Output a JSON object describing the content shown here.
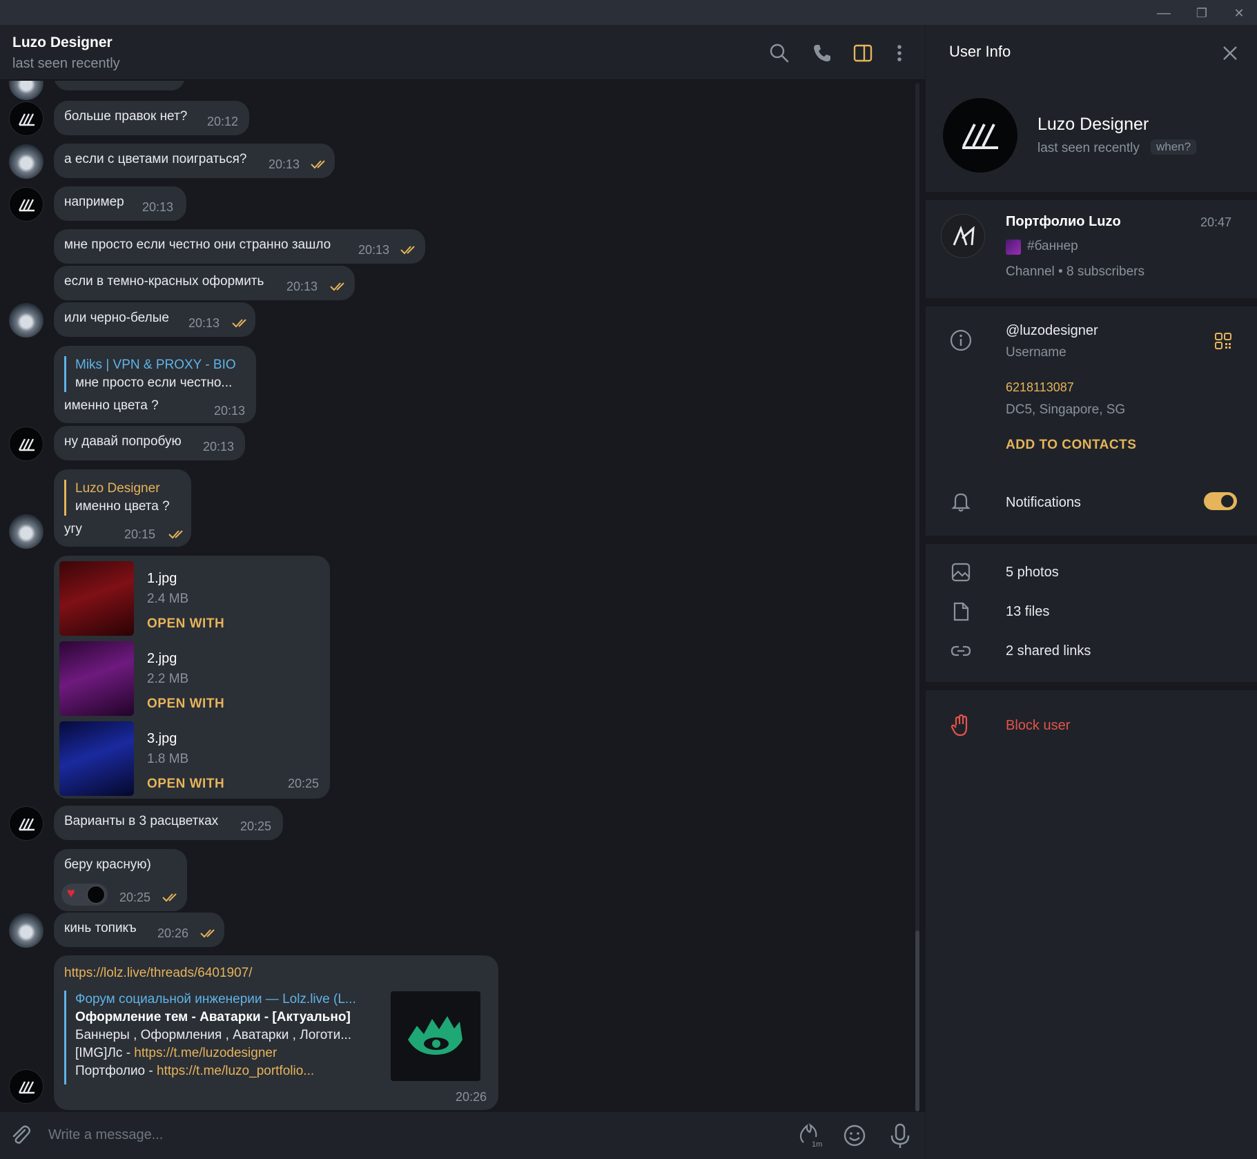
{
  "window": {
    "minimize": "—",
    "restore": "❐",
    "close": "✕"
  },
  "chat": {
    "title": "Luzo Designer",
    "status": "last seen recently"
  },
  "header_icons": [
    "search-icon",
    "phone-icon",
    "sidebar-toggle-icon",
    "more-icon"
  ],
  "messages": {
    "m1": {
      "text": "больше правок нет?",
      "time": "20:12"
    },
    "m2": {
      "text": "а если с цветами поиграться?",
      "time": "20:13"
    },
    "m3": {
      "text": "например",
      "time": "20:13"
    },
    "m4": {
      "text": "мне просто если честно они странно зашло",
      "time": "20:13"
    },
    "m5": {
      "text": "если в темно-красных оформить",
      "time": "20:13"
    },
    "m6": {
      "text": "или черно-белые",
      "time": "20:13"
    },
    "m7": {
      "reply_name": "Miks | VPN & PROXY - BIO",
      "reply_text": "мне просто если честно...",
      "text": "именно цвета ?",
      "time": "20:13"
    },
    "m8": {
      "text": "ну давай попробую",
      "time": "20:13"
    },
    "m9": {
      "reply_name": "Luzo Designer",
      "reply_text": "именно цвета ?",
      "text": "угу",
      "time": "20:15"
    },
    "m10": {
      "files": [
        {
          "name": "1.jpg",
          "size": "2.4 MB",
          "action": "OPEN WITH"
        },
        {
          "name": "2.jpg",
          "size": "2.2 MB",
          "action": "OPEN WITH"
        },
        {
          "name": "3.jpg",
          "size": "1.8 MB",
          "action": "OPEN WITH"
        }
      ],
      "time": "20:25"
    },
    "m11": {
      "text": "Варианты в 3 расцветках",
      "time": "20:25"
    },
    "m12": {
      "text": "беру красную)",
      "time": "20:25"
    },
    "m13": {
      "text": "кинь топикъ",
      "time": "20:26"
    },
    "m14": {
      "url": "https://lolz.live/threads/6401907/",
      "preview_site": "Форум социальной инженерии — Lolz.live (L...",
      "preview_title": "Оформление тем - Аватарки - [Актуально]",
      "preview_line1": "Баннеры , Оформления , Аватарки , Логоти...",
      "preview_line2_prefix": "[IMG]Лс - ",
      "preview_line2_link": "https://t.me/luzodesigner",
      "preview_line3_prefix": "Портфолио - ",
      "preview_line3_link": "https://t.me/luzo_portfolio...",
      "time": "20:26"
    }
  },
  "input": {
    "placeholder": "Write a message..."
  },
  "sidebar": {
    "title": "User Info",
    "name": "Luzo Designer",
    "status": "last seen recently",
    "when": "when?",
    "channel": {
      "name": "Портфолио Luzo",
      "time": "20:47",
      "post": "#баннер",
      "meta": "Channel • 8 subscribers"
    },
    "username": "@luzodesigner",
    "username_label": "Username",
    "user_id": "6218113087",
    "dc": "DC5, Singapore, SG",
    "add_contacts": "ADD TO CONTACTS",
    "notifications": "Notifications",
    "notifications_on": true,
    "photos": "5 photos",
    "files": "13 files",
    "links": "2 shared links",
    "block": "Block user"
  },
  "colors": {
    "accent": "#e6b45a",
    "reply_blue": "#5fb4e8",
    "danger": "#e5534b",
    "bubble": "#2b2f36",
    "background": "#17191e"
  }
}
